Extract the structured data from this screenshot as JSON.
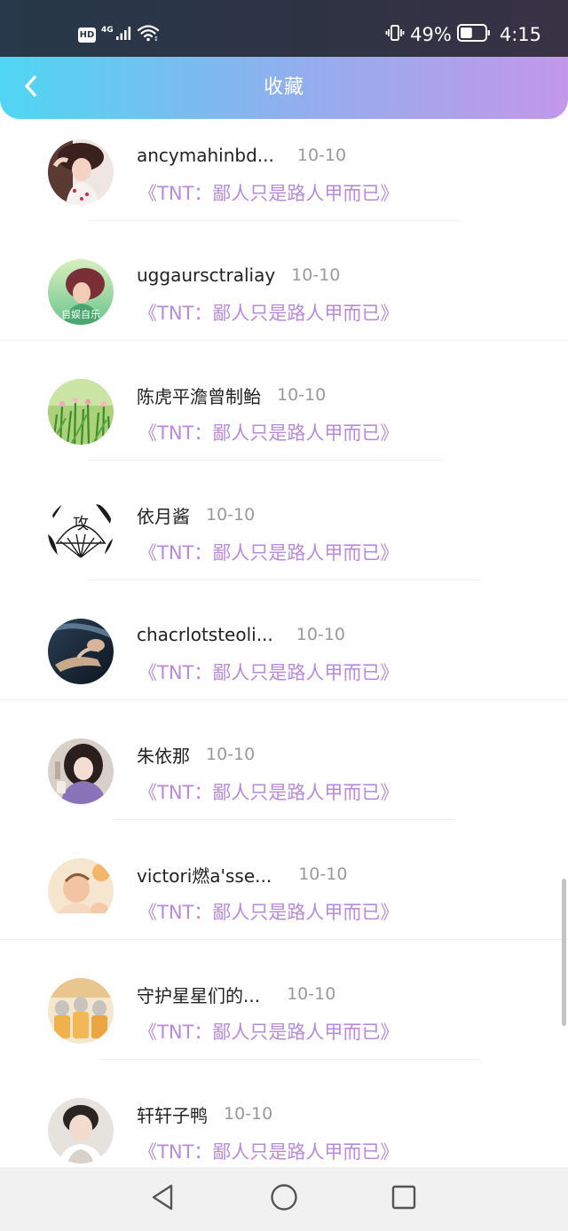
{
  "status_bar": {
    "network_badge": "HD",
    "network_type": "4G",
    "battery_percent": "49%",
    "battery_level": 0.49,
    "time": "4:15"
  },
  "header": {
    "title": "收藏"
  },
  "items": [
    {
      "username": "ancymahinbd...",
      "date": "10-10",
      "book": "《TNT：鄙人只是路人甲而已》"
    },
    {
      "username": "uggaursctraliay",
      "date": "10-10",
      "book": "《TNT：鄙人只是路人甲而已》",
      "avatar_caption": "自娱自乐"
    },
    {
      "username": "陈虎平澹曾制鲐",
      "date": "10-10",
      "book": "《TNT：鄙人只是路人甲而已》"
    },
    {
      "username": "依月酱",
      "date": "10-10",
      "book": "《TNT：鄙人只是路人甲而已》",
      "avatar_caption": "攻"
    },
    {
      "username": "chacrlotsteoli...",
      "date": "10-10",
      "book": "《TNT：鄙人只是路人甲而已》"
    },
    {
      "username": "朱依那",
      "date": "10-10",
      "book": "《TNT：鄙人只是路人甲而已》"
    },
    {
      "username": "victori燃a'sse...",
      "date": "10-10",
      "book": "《TNT：鄙人只是路人甲而已》"
    },
    {
      "username": "守护星星们的...",
      "date": "10-10",
      "book": "《TNT：鄙人只是路人甲而已》"
    },
    {
      "username": "轩轩子鸭",
      "date": "10-10",
      "book": "《TNT：鄙人只是路人甲而已》"
    }
  ],
  "colors": {
    "header_gradient_start": "#4fd6f2",
    "header_gradient_end": "#c397ea",
    "book_title": "#b98adc",
    "date_text": "#9a9a9a"
  }
}
